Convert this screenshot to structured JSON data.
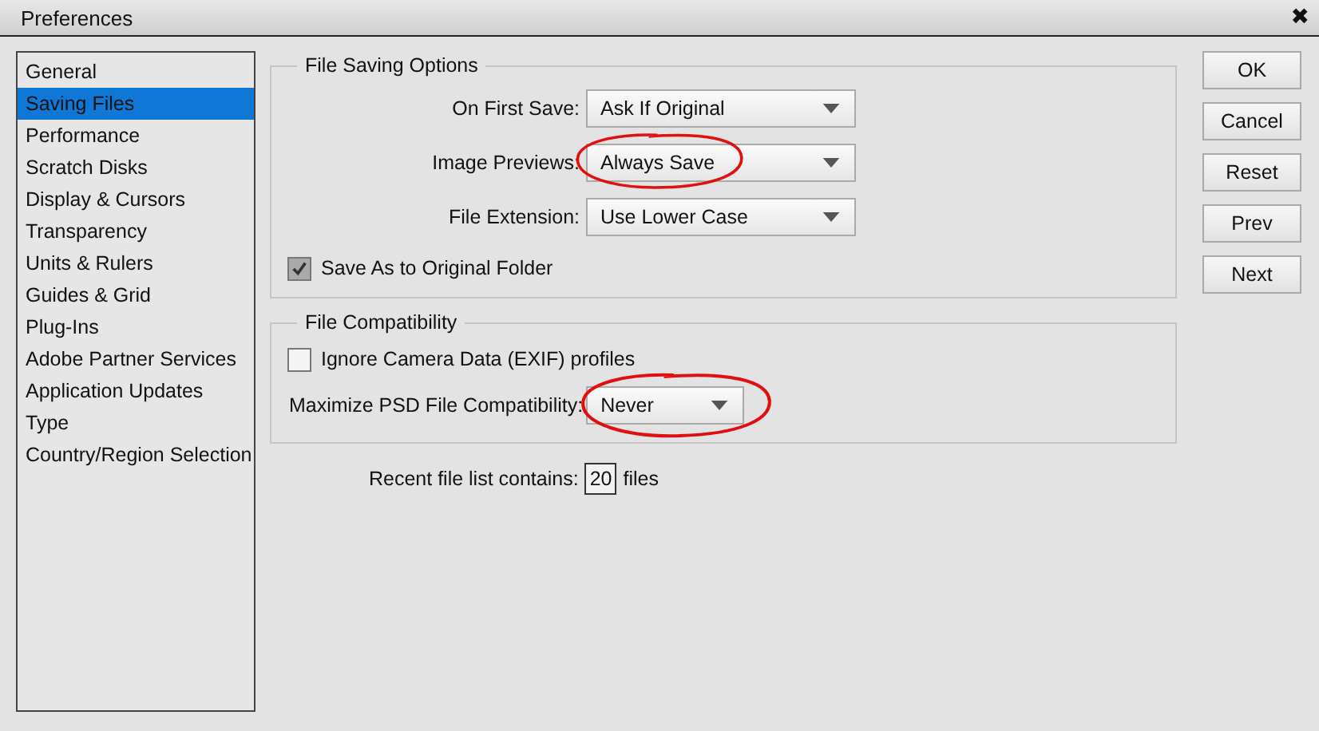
{
  "window": {
    "title": "Preferences",
    "close": "✖"
  },
  "sidebar": {
    "items": [
      {
        "label": "General",
        "selected": false
      },
      {
        "label": "Saving Files",
        "selected": true
      },
      {
        "label": "Performance",
        "selected": false
      },
      {
        "label": "Scratch Disks",
        "selected": false
      },
      {
        "label": "Display & Cursors",
        "selected": false
      },
      {
        "label": "Transparency",
        "selected": false
      },
      {
        "label": "Units & Rulers",
        "selected": false
      },
      {
        "label": "Guides & Grid",
        "selected": false
      },
      {
        "label": "Plug-Ins",
        "selected": false
      },
      {
        "label": "Adobe Partner Services",
        "selected": false
      },
      {
        "label": "Application Updates",
        "selected": false
      },
      {
        "label": "Type",
        "selected": false
      },
      {
        "label": "Country/Region Selection",
        "selected": false
      }
    ]
  },
  "groups": [
    {
      "title": "File Saving Options",
      "rows": [
        {
          "kind": "select",
          "label": "On First Save:",
          "value": "Ask If Original",
          "circled": false
        },
        {
          "kind": "select",
          "label": "Image Previews:",
          "value": "Always Save",
          "circled": true
        },
        {
          "kind": "select",
          "label": "File Extension:",
          "value": "Use Lower Case",
          "circled": false
        },
        {
          "kind": "checkbox",
          "label": "Save As to Original Folder",
          "checked": true
        }
      ]
    },
    {
      "title": "File Compatibility",
      "rows": [
        {
          "kind": "checkbox",
          "label": "Ignore Camera Data (EXIF) profiles",
          "checked": false
        },
        {
          "kind": "select-left",
          "label": "Maximize PSD File Compatibility:",
          "value": "Never",
          "circled": true
        }
      ]
    }
  ],
  "recent": {
    "label": "Recent file list contains:",
    "value": "20",
    "unit": "files"
  },
  "buttons": [
    "OK",
    "Cancel",
    "Reset",
    "Prev",
    "Next"
  ]
}
